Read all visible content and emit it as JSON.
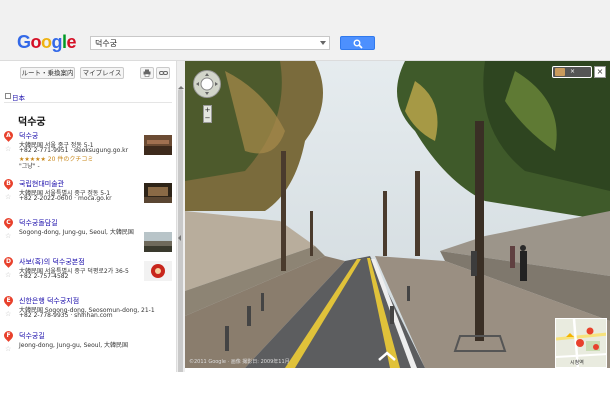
{
  "header": {
    "logo": {
      "letters": [
        "G",
        "o",
        "o",
        "g",
        "l",
        "e"
      ],
      "colors": [
        "#3369e8",
        "#d50f25",
        "#eeb211",
        "#3369e8",
        "#009925",
        "#d50f25"
      ]
    },
    "search": {
      "value": "덕수궁"
    },
    "search_button_icon": "search-icon"
  },
  "sidebar": {
    "route_button": "ルート・乗換案内",
    "myplaces_button": "マイプレイス",
    "print_icon": "print-icon",
    "link_icon": "link-icon",
    "language": "日本",
    "title": "덕수궁",
    "results": [
      {
        "marker": "A",
        "name": "덕수궁",
        "lines": [
          "大韓民国 서울 중구 정동 5-1",
          "+82 2-771-9951 · deoksugung.go.kr",
          "★★★★★ 20 件のクチコミ",
          "\"그냥\" -"
        ]
      },
      {
        "marker": "B",
        "name": "국립현대미술관",
        "lines": [
          "大韓民国 서울특별시 중구 정동 5-1",
          "+82 2-2022-0600 · moca.go.kr"
        ]
      },
      {
        "marker": "C",
        "name": "덕수궁돌담길",
        "lines": [
          "Sogong-dong, Jung-gu, Seoul, 大韓民国"
        ]
      },
      {
        "marker": "D",
        "name": "사보(혹)의 덕수궁본점",
        "lines": [
          "大韓民国 서울특별시 중구 덕평로2가 36-5",
          "+82 2-757-4582"
        ]
      },
      {
        "marker": "E",
        "name": "신한은행 덕수궁지점",
        "lines": [
          "大韓民国 Sogong-dong, Seosomun-dong, 21-1",
          "+82 2-778-9935 · shinhan.com"
        ]
      },
      {
        "marker": "F",
        "name": "덕수궁길",
        "lines": [
          "Jeong-dong, Jung-gu, Seoul, 大韓民国"
        ]
      }
    ]
  },
  "streetview": {
    "close_label": "×",
    "zoom_plus": "+",
    "zoom_minus": "−",
    "footer": "©2011 Google · 画像 撮影日: 2009年11月",
    "minimap_label": "시청역"
  }
}
